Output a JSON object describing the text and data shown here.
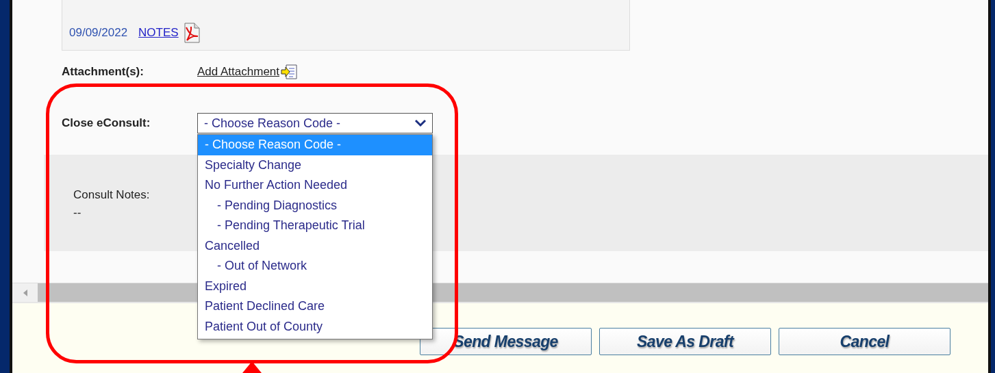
{
  "notes_box": {
    "date": "09/09/2022",
    "link": "NOTES"
  },
  "attachments": {
    "label": "Attachment(s):",
    "link": "Add Attachment"
  },
  "close_econsult": {
    "label": "Close eConsult:",
    "value": "- Choose Reason Code -",
    "expanded": true,
    "options": [
      {
        "text": "- Choose Reason Code -",
        "kind": "top",
        "selected": true
      },
      {
        "text": "Specialty Change",
        "kind": "top",
        "selected": false
      },
      {
        "text": "No Further Action Needed",
        "kind": "top",
        "selected": false
      },
      {
        "text": "- Pending Diagnostics",
        "kind": "sub",
        "selected": false
      },
      {
        "text": "- Pending Therapeutic Trial",
        "kind": "sub",
        "selected": false
      },
      {
        "text": "Cancelled",
        "kind": "top",
        "selected": false
      },
      {
        "text": "- Out of Network",
        "kind": "sub",
        "selected": false
      },
      {
        "text": "Expired",
        "kind": "top",
        "selected": false
      },
      {
        "text": "Patient Declined Care",
        "kind": "top",
        "selected": false
      },
      {
        "text": "Patient Out of County",
        "kind": "top",
        "selected": false
      }
    ]
  },
  "consult_notes": {
    "label": "Consult Notes:",
    "value": "--"
  },
  "buttons": [
    "Send Message",
    "Save As Draft",
    "Cancel"
  ]
}
